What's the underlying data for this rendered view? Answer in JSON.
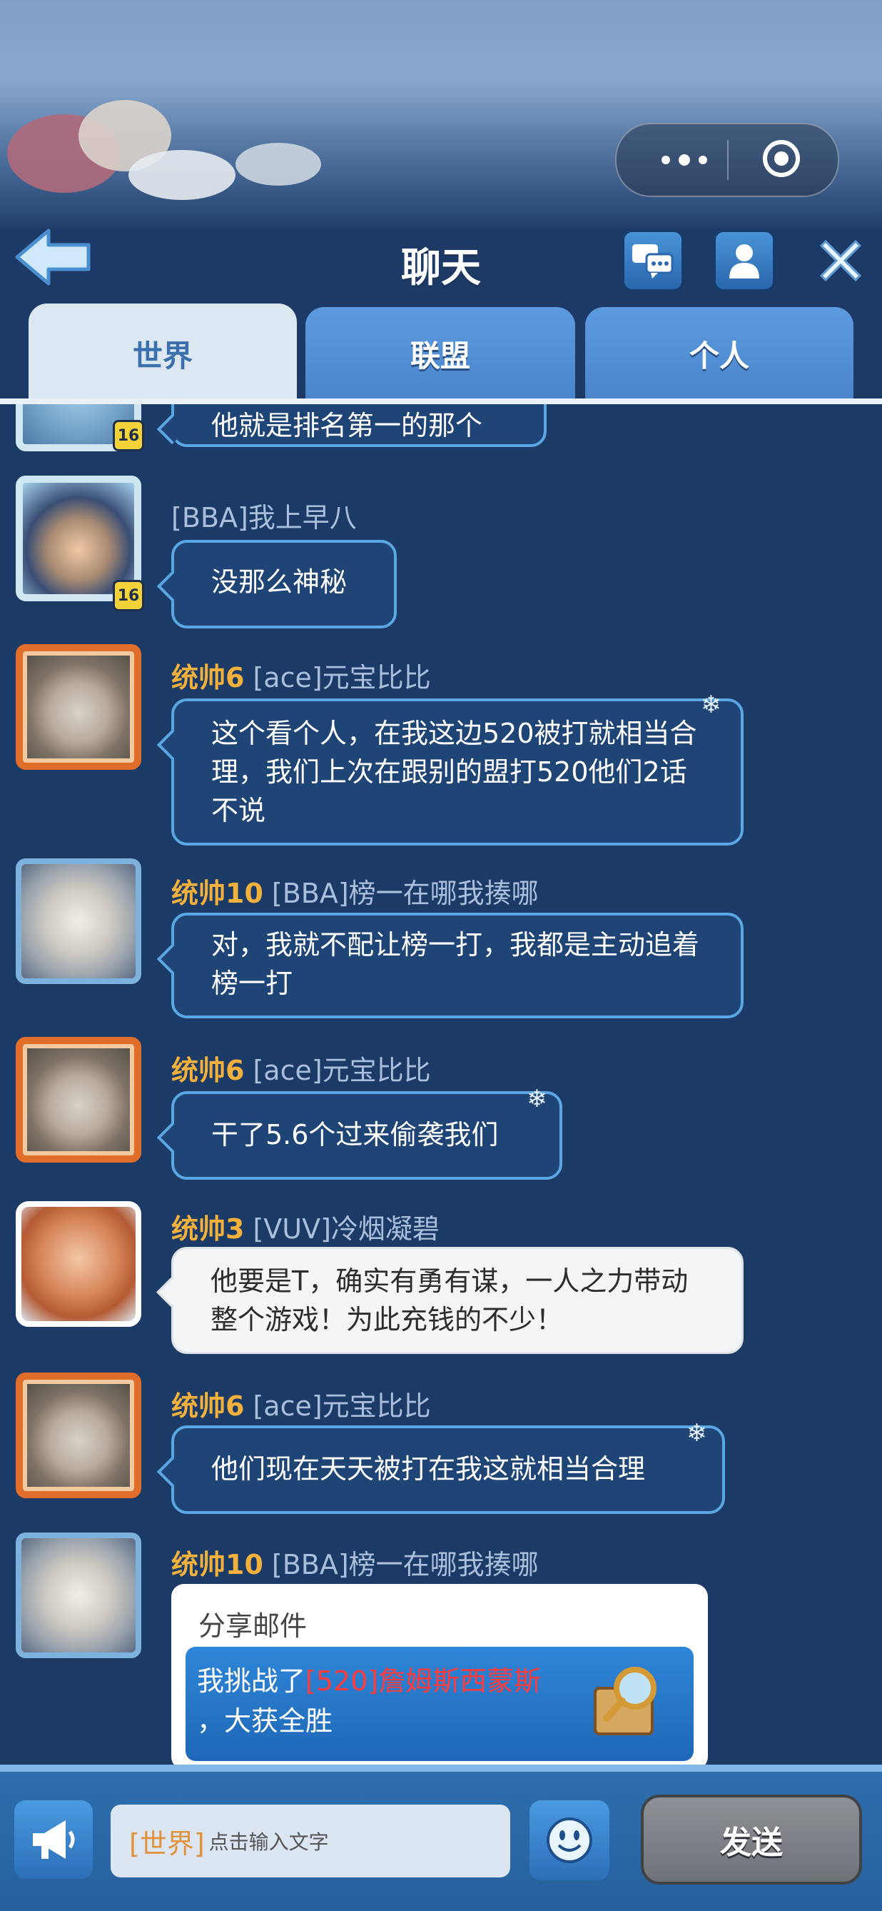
{
  "header": {
    "title": "聊天"
  },
  "tabs": [
    {
      "label": "世界",
      "active": true
    },
    {
      "label": "联盟",
      "active": false
    },
    {
      "label": "个人",
      "active": false
    }
  ],
  "messages": [
    {
      "text": "他就是排名第一的那个",
      "level": "16"
    },
    {
      "rank": "",
      "sender": "[BBA]我上早八",
      "text": "没那么神秘",
      "level": "16"
    },
    {
      "rank": "统帅6",
      "sender": "[ace]元宝比比",
      "text": "这个看个人，在我这边520被打就相当合理，我们上次在跟别的盟打520他们2话不说"
    },
    {
      "rank": "统帅10",
      "sender": "[BBA]榜一在哪我揍哪",
      "text": "对，我就不配让榜一打，我都是主动追着榜一打"
    },
    {
      "rank": "统帅6",
      "sender": "[ace]元宝比比",
      "text": "干了5.6个过来偷袭我们"
    },
    {
      "rank": "统帅3",
      "sender": "[VUV]冷烟凝碧",
      "text": "他要是T，确实有勇有谋，一人之力带动整个游戏！为此充钱的不少！"
    },
    {
      "rank": "统帅6",
      "sender": "[ace]元宝比比",
      "text": "他们现在天天被打在我这就相当合理"
    },
    {
      "rank": "统帅10",
      "sender": "[BBA]榜一在哪我揍哪"
    }
  ],
  "share_mail": {
    "header": "分享邮件",
    "prefix": "我挑战了",
    "target": "[520]詹姆斯西蒙斯",
    "suffix": "，大获全胜"
  },
  "input": {
    "channel_tag": "[世界]",
    "placeholder": "点击输入文字"
  },
  "send_label": "发送"
}
